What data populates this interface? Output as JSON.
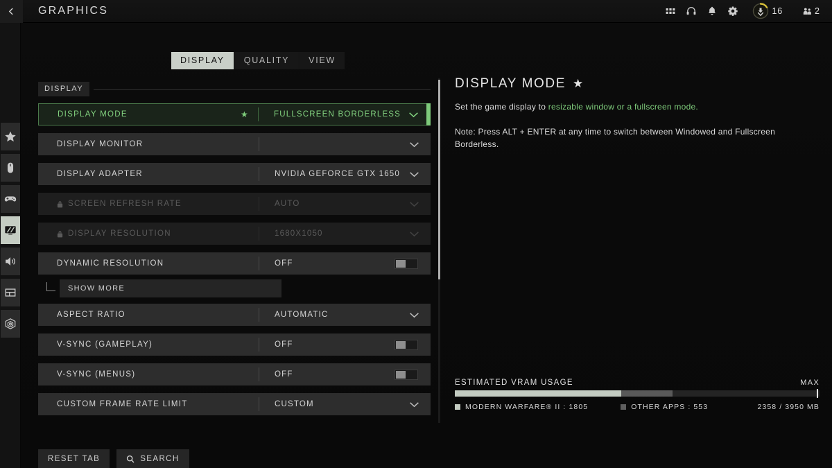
{
  "header": {
    "back_icon": "chevron-left-icon",
    "title": "GRAPHICS",
    "icons": [
      {
        "name": "grid-menu-icon"
      },
      {
        "name": "headset-icon"
      },
      {
        "name": "bell-icon"
      },
      {
        "name": "gear-icon"
      }
    ],
    "rank": {
      "icon": "rank-badge-icon",
      "level": "16"
    },
    "squad": {
      "icon": "squad-icon",
      "count": "2"
    }
  },
  "rail": {
    "items": [
      {
        "name": "sidebar-item-favorites",
        "icon": "star-icon",
        "active": false
      },
      {
        "name": "sidebar-item-mouse",
        "icon": "mouse-icon",
        "active": false
      },
      {
        "name": "sidebar-item-controller",
        "icon": "gamepad-icon",
        "active": false
      },
      {
        "name": "sidebar-item-graphics",
        "icon": "monitor-icon",
        "active": true
      },
      {
        "name": "sidebar-item-audio",
        "icon": "speaker-icon",
        "active": false
      },
      {
        "name": "sidebar-item-interface",
        "icon": "layout-icon",
        "active": false
      },
      {
        "name": "sidebar-item-account",
        "icon": "account-network-icon",
        "active": false
      }
    ]
  },
  "tabs": [
    {
      "label": "DISPLAY",
      "active": true
    },
    {
      "label": "QUALITY",
      "active": false
    },
    {
      "label": "VIEW",
      "active": false
    }
  ],
  "settings": {
    "section_label": "DISPLAY",
    "rows": [
      {
        "name": "DISPLAY MODE",
        "value": "FULLSCREEN BORDERLESS",
        "control": "dropdown",
        "state": "selected",
        "favorited": true
      },
      {
        "name": "DISPLAY MONITOR",
        "value": "",
        "control": "dropdown",
        "state": "normal",
        "favorited": false
      },
      {
        "name": "DISPLAY ADAPTER",
        "value": "NVIDIA GEFORCE GTX 1650",
        "control": "dropdown",
        "state": "normal",
        "favorited": false
      },
      {
        "name": "SCREEN REFRESH RATE",
        "value": "AUTO",
        "control": "dropdown",
        "state": "disabled",
        "favorited": false
      },
      {
        "name": "DISPLAY RESOLUTION",
        "value": "1680X1050",
        "control": "dropdown",
        "state": "disabled",
        "favorited": false
      },
      {
        "name": "DYNAMIC RESOLUTION",
        "value": "OFF",
        "control": "toggle",
        "state": "normal",
        "favorited": false
      },
      {
        "name": "ASPECT RATIO",
        "value": "AUTOMATIC",
        "control": "dropdown",
        "state": "normal",
        "favorited": false
      },
      {
        "name": "V-SYNC (GAMEPLAY)",
        "value": "OFF",
        "control": "toggle",
        "state": "normal",
        "favorited": false
      },
      {
        "name": "V-SYNC (MENUS)",
        "value": "OFF",
        "control": "toggle",
        "state": "normal",
        "favorited": false
      },
      {
        "name": "CUSTOM FRAME RATE LIMIT",
        "value": "CUSTOM",
        "control": "dropdown",
        "state": "normal",
        "favorited": false
      }
    ],
    "show_more_label": "SHOW MORE"
  },
  "detail": {
    "title": "DISPLAY MODE",
    "favorited_star": "★",
    "desc_plain": "Set the game display to ",
    "desc_highlight": "resizable window or a fullscreen mode.",
    "note": "Note: Press ALT + ENTER at any time to switch between Windowed and Fullscreen Borderless."
  },
  "vram": {
    "label": "ESTIMATED VRAM USAGE",
    "max_label": "MAX",
    "total": "2358 / 3950 MB",
    "legend": [
      {
        "label": "MODERN WARFARE® II : 1805",
        "color": "#c3cbc1"
      },
      {
        "label": "OTHER APPS : 553",
        "color": "#5e5e5e"
      }
    ]
  },
  "footer": {
    "reset_label": "RESET TAB",
    "search_label": "SEARCH",
    "search_icon": "search-icon"
  },
  "colors": {
    "accent_green": "#7ecb7b",
    "rank_gold": "#d9c23a",
    "bar_primary": "#c3cbc1",
    "bar_secondary": "#5e5e5e"
  },
  "chart_data": {
    "type": "bar",
    "title": "ESTIMATED VRAM USAGE",
    "categories": [
      "MODERN WARFARE® II",
      "OTHER APPS"
    ],
    "values": [
      1805,
      553
    ],
    "unit": "MB",
    "total_used": 2358,
    "total_capacity": 3950,
    "max_marker": 3950,
    "ylabel": "MB",
    "xlabel": ""
  }
}
